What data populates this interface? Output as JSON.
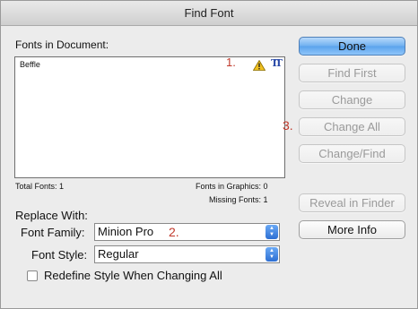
{
  "window": {
    "title": "Find Font"
  },
  "fonts_section": {
    "label": "Fonts in Document:",
    "items": [
      {
        "name": "Beffle",
        "annotation": "1.",
        "icons": [
          "warning-icon",
          "font-type-icon"
        ]
      }
    ],
    "total_fonts": "Total Fonts: 1",
    "fonts_in_graphics": "Fonts in Graphics: 0",
    "missing_fonts": "Missing Fonts: 1"
  },
  "buttons": {
    "done": "Done",
    "find_first": "Find First",
    "change": "Change",
    "change_all": "Change All",
    "change_find": "Change/Find",
    "reveal_in_finder": "Reveal in Finder",
    "more_info": "More Info"
  },
  "annotations": {
    "change_all": "3.",
    "font_family": "2."
  },
  "replace": {
    "heading": "Replace With:",
    "font_family_label": "Font Family:",
    "font_family_value": "Minion Pro",
    "font_style_label": "Font Style:",
    "font_style_value": "Regular",
    "redefine_label": "Redefine Style When Changing All",
    "redefine_checked": false
  },
  "colors": {
    "accent": "#5aa2ec",
    "annotation": "#c0392b",
    "warning": "#f0c020"
  }
}
